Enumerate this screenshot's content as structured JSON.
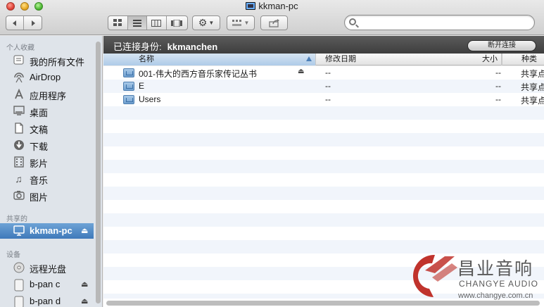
{
  "window": {
    "title": "kkman-pc"
  },
  "toolbar": {
    "back_icon": "chevron-left-icon",
    "forward_icon": "chevron-right-icon",
    "view_modes": [
      "icon-view-icon",
      "list-view-icon",
      "column-view-icon",
      "coverflow-view-icon"
    ],
    "action_icon": "gear-icon",
    "arrange_icon": "arrange-icon",
    "share_icon": "share-icon",
    "search": {
      "value": "",
      "placeholder": ""
    }
  },
  "sidebar": {
    "favorites_header": "个人收藏",
    "favorites": [
      {
        "label": "我的所有文件",
        "icon": "all-files-icon"
      },
      {
        "label": "AirDrop",
        "icon": "airdrop-icon"
      },
      {
        "label": "应用程序",
        "icon": "applications-icon"
      },
      {
        "label": "桌面",
        "icon": "desktop-icon"
      },
      {
        "label": "文稿",
        "icon": "documents-icon"
      },
      {
        "label": "下载",
        "icon": "downloads-icon"
      },
      {
        "label": "影片",
        "icon": "movies-icon"
      },
      {
        "label": "音乐",
        "icon": "music-icon"
      },
      {
        "label": "图片",
        "icon": "pictures-icon"
      }
    ],
    "shared_header": "共享的",
    "shared": [
      {
        "label": "kkman-pc",
        "icon": "computer-icon",
        "selected": true
      }
    ],
    "devices_header": "设备",
    "devices": [
      {
        "label": "远程光盘",
        "icon": "optical-disc-icon"
      },
      {
        "label": "b-pan c",
        "icon": "drive-icon"
      },
      {
        "label": "b-pan d",
        "icon": "drive-icon"
      }
    ]
  },
  "connection": {
    "status_label": "已连接身份:",
    "user": "kkmanchen",
    "disconnect_label": "断开连接"
  },
  "columns": {
    "name": "名称",
    "date": "修改日期",
    "size": "大小",
    "kind": "种类"
  },
  "files": [
    {
      "name": "001-伟大的西方音乐家传记丛书",
      "date": "--",
      "size": "--",
      "kind": "共享点",
      "ejectable": true
    },
    {
      "name": "E",
      "date": "--",
      "size": "--",
      "kind": "共享点",
      "ejectable": false
    },
    {
      "name": "Users",
      "date": "--",
      "size": "--",
      "kind": "共享点",
      "ejectable": false
    }
  ],
  "watermark": {
    "brand_cn": "昌业音响",
    "brand_en": "CHANGYE AUDIO",
    "url": "www.changye.com.cn",
    "color": "#c0332c"
  }
}
